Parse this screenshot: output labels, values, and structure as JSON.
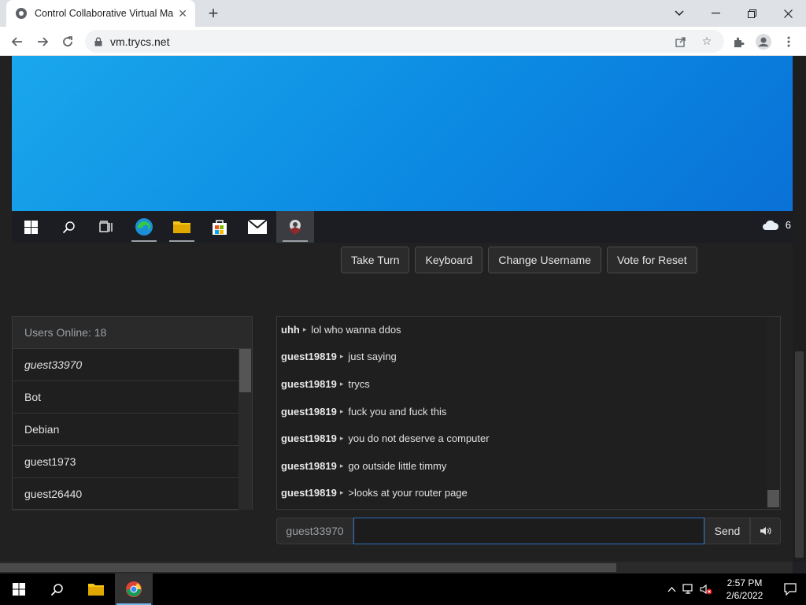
{
  "browser": {
    "tab_title": "Control Collaborative Virtual Ma",
    "url": "vm.trycs.net"
  },
  "vm": {
    "weather_temp": "6"
  },
  "controls": {
    "take_turn": "Take Turn",
    "keyboard": "Keyboard",
    "change_username": "Change Username",
    "vote_reset": "Vote for Reset"
  },
  "users": {
    "header": "Users Online: 18",
    "list": [
      "guest33970",
      "Bot",
      "Debian",
      "guest1973",
      "guest26440"
    ]
  },
  "chat": {
    "messages": [
      {
        "user": "uhh",
        "text": "lol who wanna ddos"
      },
      {
        "user": "guest19819",
        "text": "just saying"
      },
      {
        "user": "guest19819",
        "text": "trycs"
      },
      {
        "user": "guest19819",
        "text": "fuck you and fuck this"
      },
      {
        "user": "guest19819",
        "text": "you do not deserve a computer"
      },
      {
        "user": "guest19819",
        "text": "go outside little timmy"
      },
      {
        "user": "guest19819",
        "text": ">looks at your router page"
      }
    ],
    "username": "guest33970",
    "input_value": "",
    "send_label": "Send"
  },
  "taskbar": {
    "time": "2:57 PM",
    "date": "2/6/2022"
  },
  "colors": {
    "accent": "#0b89e2",
    "page_bg": "#212121"
  }
}
